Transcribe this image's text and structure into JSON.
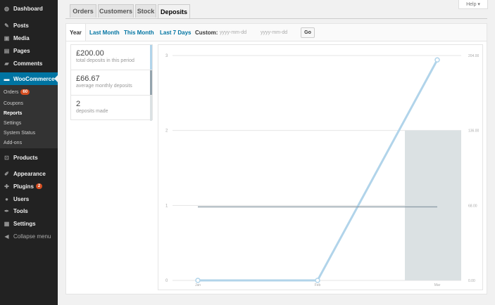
{
  "sidebar": {
    "dashboard": "Dashboard",
    "posts": "Posts",
    "media": "Media",
    "pages": "Pages",
    "comments": "Comments",
    "woocommerce": "WooCommerce",
    "submenu": {
      "orders": "Orders",
      "orders_badge": "60",
      "coupons": "Coupons",
      "reports": "Reports",
      "settings": "Settings",
      "system_status": "System Status",
      "addons": "Add-ons"
    },
    "products": "Products",
    "appearance": "Appearance",
    "plugins": "Plugins",
    "plugins_badge": "2",
    "users": "Users",
    "tools": "Tools",
    "settings": "Settings",
    "collapse": "Collapse menu"
  },
  "help": "Help ▾",
  "tabs": [
    "Orders",
    "Customers",
    "Stock",
    "Deposits"
  ],
  "range": {
    "year": "Year",
    "last_month": "Last Month",
    "this_month": "This Month",
    "last_7_days": "Last 7 Days",
    "custom": "Custom:",
    "from_placeholder": "yyyy-mm-dd",
    "to_placeholder": "yyyy-mm-dd",
    "go": "Go"
  },
  "legend": [
    {
      "value": "£200.00",
      "label": "total deposits in this period",
      "color": "#b1d4ea"
    },
    {
      "value": "£66.67",
      "label": "average monthly deposits",
      "color": "#94a3ad"
    },
    {
      "value": "2",
      "label": "deposits made",
      "color": "#dbe1e3"
    }
  ],
  "chart_data": {
    "type": "line",
    "categories": [
      "Jan",
      "Feb",
      "Mar"
    ],
    "left_axis": {
      "ticks": [
        "0",
        "1",
        "2",
        "3"
      ],
      "min": 0,
      "max": 3
    },
    "right_axis": {
      "ticks": [
        "0.00",
        "68.00",
        "136.00",
        "204.00"
      ],
      "min": 0,
      "max": 204
    },
    "series": [
      {
        "name": "total deposits in this period",
        "axis": "right",
        "chart": "line",
        "values": [
          0,
          0,
          200
        ],
        "color": "#b1d4ea"
      },
      {
        "name": "average monthly deposits",
        "axis": "right",
        "chart": "line",
        "values": [
          66.67,
          66.67,
          66.67
        ],
        "color": "#94a3ad"
      },
      {
        "name": "deposits made",
        "axis": "left",
        "chart": "bar",
        "values": [
          0,
          0,
          2
        ],
        "color": "#dbe1e3"
      }
    ]
  }
}
